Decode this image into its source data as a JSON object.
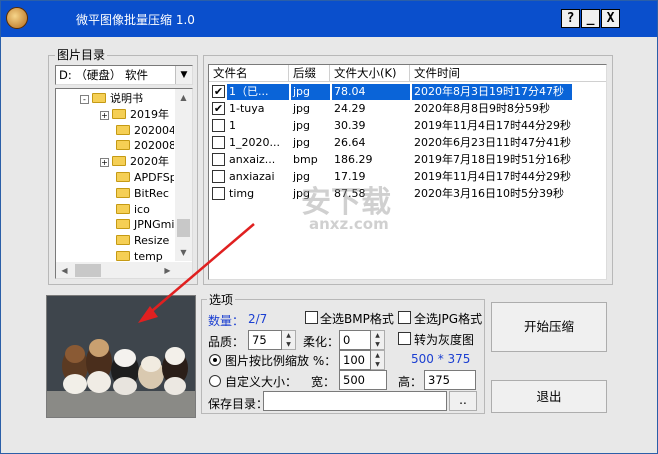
{
  "window": {
    "title": "微平图像批量压缩 1.0",
    "buttons": {
      "help": "?",
      "minimize": "_",
      "close": "X"
    }
  },
  "dir_panel": {
    "label": "图片目录",
    "drive": "D: （硬盘） 软件",
    "tree": [
      {
        "label": "说明书",
        "expanded": true
      },
      {
        "label": "2019年",
        "expandable": true
      },
      {
        "label": "202004"
      },
      {
        "label": "202008"
      },
      {
        "label": "2020年",
        "expandable": true
      },
      {
        "label": "APDFSpl"
      },
      {
        "label": "BitRec"
      },
      {
        "label": "ico"
      },
      {
        "label": "JPNGmin"
      },
      {
        "label": "Resize"
      },
      {
        "label": "temp"
      }
    ]
  },
  "file_list": {
    "columns": [
      "文件名",
      "后缀",
      "文件大小(K)",
      "文件时间"
    ],
    "rows": [
      {
        "checked": true,
        "selected": true,
        "name": "1（已...",
        "ext": "jpg",
        "size": "78.04",
        "time": "2020年8月3日19时17分47秒"
      },
      {
        "checked": true,
        "selected": false,
        "name": "1-tuya",
        "ext": "jpg",
        "size": "24.29",
        "time": "2020年8月8日9时8分59秒"
      },
      {
        "checked": false,
        "selected": false,
        "name": "1",
        "ext": "jpg",
        "size": "30.39",
        "time": "2019年11月4日17时44分29秒"
      },
      {
        "checked": false,
        "selected": false,
        "name": "1_2020...",
        "ext": "jpg",
        "size": "26.64",
        "time": "2020年6月23日11时47分41秒"
      },
      {
        "checked": false,
        "selected": false,
        "name": "anxaiz...",
        "ext": "bmp",
        "size": "186.29",
        "time": "2019年7月18日19时51分16秒"
      },
      {
        "checked": false,
        "selected": false,
        "name": "anxiazai",
        "ext": "jpg",
        "size": "17.19",
        "time": "2019年11月4日17时44分29秒"
      },
      {
        "checked": false,
        "selected": false,
        "name": "timg",
        "ext": "jpg",
        "size": "87.58",
        "time": "2020年3月16日10时5分39秒"
      }
    ]
  },
  "options": {
    "label": "选项",
    "count_label": "数量：",
    "count_value": "2/7",
    "select_all_bmp": "全选BMP格式",
    "select_all_jpg": "全选JPG格式",
    "quality_label": "品质：",
    "quality_value": "75",
    "sharpen_label": "柔化：",
    "sharpen_value": "0",
    "grayscale_label": "转为灰度图",
    "scale_radio": "图片按比例缩放 %：",
    "scale_value": "100",
    "dims_text": "500 * 375",
    "custom_radio": "自定义大小：",
    "width_label": "宽：",
    "width_value": "500",
    "height_label": "高：",
    "height_value": "375",
    "save_dir_label": "保存目录：",
    "save_dir_value": "",
    "browse": ".."
  },
  "actions": {
    "start": "开始压缩",
    "exit": "退出"
  },
  "watermark": {
    "text": "安下载",
    "url": "anxz.com"
  },
  "colors": {
    "titlebar": "#0a4fcc",
    "selection": "#0a64d8",
    "count_value": "#1b3fd1",
    "arrow": "#e02020"
  }
}
